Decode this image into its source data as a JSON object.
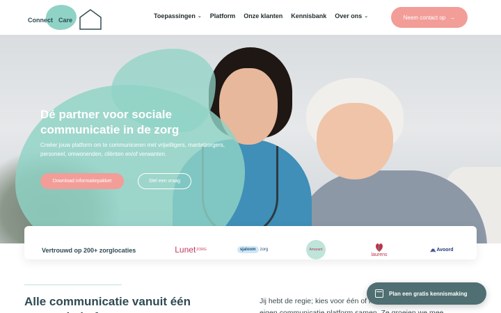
{
  "header": {
    "logo_text_1": "Connect",
    "logo_text_2": "Care",
    "nav": [
      {
        "label": "Toepassingen",
        "has_dropdown": true
      },
      {
        "label": "Platform",
        "has_dropdown": false
      },
      {
        "label": "Onze klanten",
        "has_dropdown": false
      },
      {
        "label": "Kennisbank",
        "has_dropdown": false
      },
      {
        "label": "Over ons",
        "has_dropdown": true
      }
    ],
    "cta_label": "Neem contact op",
    "cta_arrow": "→"
  },
  "hero": {
    "title": "Dé partner voor sociale communicatie in de zorg",
    "subtitle": "Creëer jouw platform om te communiceren met vrijwilligers, mantelzorgers, personeel, omwonenden, cliënten en/of verwanten.",
    "primary_button": "Download informatiepakket",
    "secondary_button": "Stel een vraag"
  },
  "trust": {
    "label": "Vertrouwd op 200+ zorglocaties",
    "logos": {
      "lunet": "Lunet",
      "lunet_suffix": "ZORG",
      "sjaloom": "sjaloom",
      "sjaloom_suffix": "zorg",
      "amarant": "Amarant",
      "laurens": "laurens",
      "avoord": "Avoord"
    }
  },
  "section": {
    "title": "Alle communicatie vanuit één centraal platform",
    "text": "Jij hebt de regie; kies voor één of meerdere toepassingen en stel je eigen communicatie platform samen. Ze groeien we mee."
  },
  "floating_button": {
    "label": "Plan een gratis kennismaking",
    "icon": "calendar-icon"
  },
  "colors": {
    "accent_coral": "#f29d98",
    "mint": "#8fd3c6",
    "dark_teal": "#2e4a52",
    "floating_button_bg": "#4f6f72"
  }
}
